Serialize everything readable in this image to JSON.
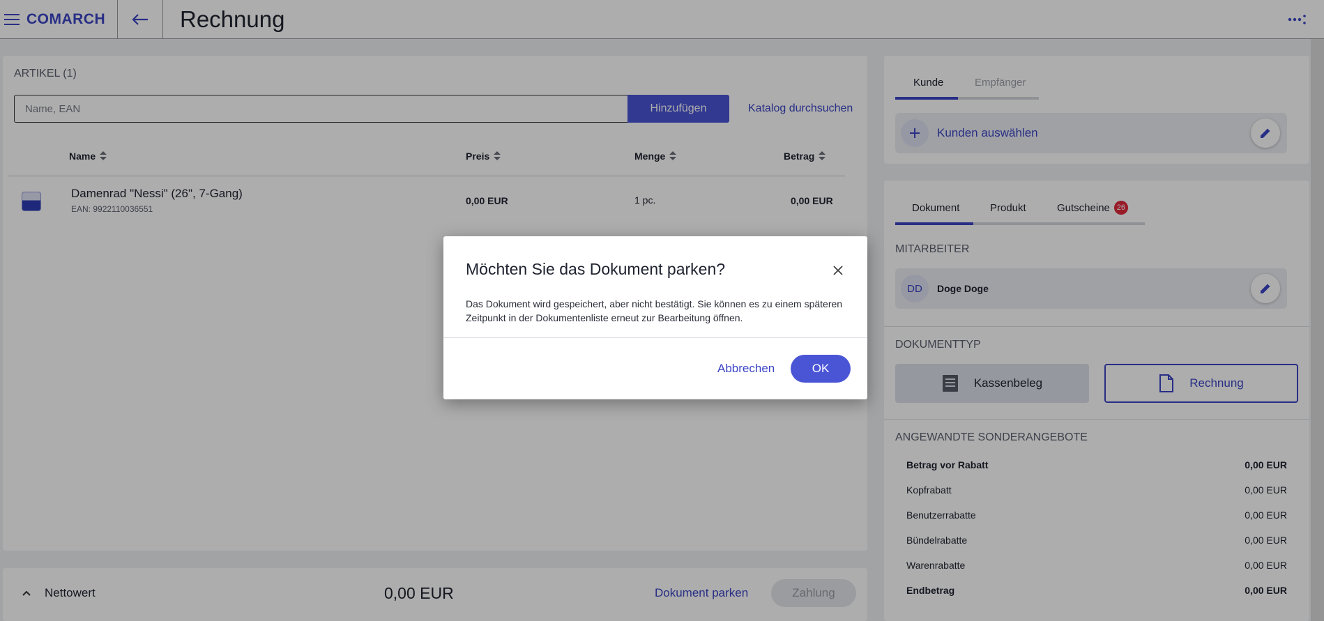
{
  "header": {
    "logo": "COMARCH",
    "title": "Rechnung"
  },
  "articles": {
    "title": "ARTIKEL (1)",
    "search_placeholder": "Name, EAN",
    "add_button": "Hinzufügen",
    "catalog_link": "Katalog durchsuchen",
    "columns": {
      "name": "Name",
      "price": "Preis",
      "qty": "Menge",
      "amount": "Betrag"
    },
    "items": [
      {
        "name": "Damenrad \"Nessi\" (26\", 7-Gang)",
        "ean": "EAN: 9922110036551",
        "price": "0,00 EUR",
        "qty": "1 pc.",
        "amount": "0,00 EUR"
      }
    ]
  },
  "footer": {
    "net_label": "Nettowert",
    "net_value": "0,00 EUR",
    "park_link": "Dokument parken",
    "pay_button": "Zahlung"
  },
  "customer": {
    "tabs": [
      "Kunde",
      "Empfänger"
    ],
    "select_label": "Kunden auswählen"
  },
  "document": {
    "tabs": [
      "Dokument",
      "Produkt",
      "Gutscheine"
    ],
    "voucher_badge": "26",
    "employee_title": "MITARBEITER",
    "employee_initials": "DD",
    "employee_name": "Doge Doge",
    "doctype_title": "DOKUMENTTYP",
    "doctype_receipt": "Kassenbeleg",
    "doctype_invoice": "Rechnung",
    "offers_title": "ANGEWANDTE SONDERANGEBOTE",
    "offers": [
      {
        "label": "Betrag vor Rabatt",
        "value": "0,00 EUR"
      },
      {
        "label": "Kopfrabatt",
        "value": "0,00 EUR"
      },
      {
        "label": "Benutzerrabatte",
        "value": "0,00 EUR"
      },
      {
        "label": "Bündelrabatte",
        "value": "0,00 EUR"
      },
      {
        "label": "Warenrabatte",
        "value": "0,00 EUR"
      },
      {
        "label": "Endbetrag",
        "value": "0,00 EUR"
      }
    ]
  },
  "modal": {
    "title": "Möchten Sie das Dokument parken?",
    "message": "Das Dokument wird gespeichert, aber nicht bestätigt. Sie können es zu einem späteren Zeitpunkt in der Dokumentenliste erneut zur Bearbeitung öffnen.",
    "cancel": "Abbrechen",
    "ok": "OK"
  },
  "colors": {
    "accent": "#3b45c4",
    "button": "#4a55d6",
    "badge": "#e0283c"
  },
  "icons": [
    "menu-icon",
    "arrow-left-icon",
    "more-icon",
    "close-icon",
    "plus-icon",
    "pencil-icon",
    "receipt-icon",
    "document-icon",
    "chevron-up-icon",
    "sort-icon"
  ]
}
